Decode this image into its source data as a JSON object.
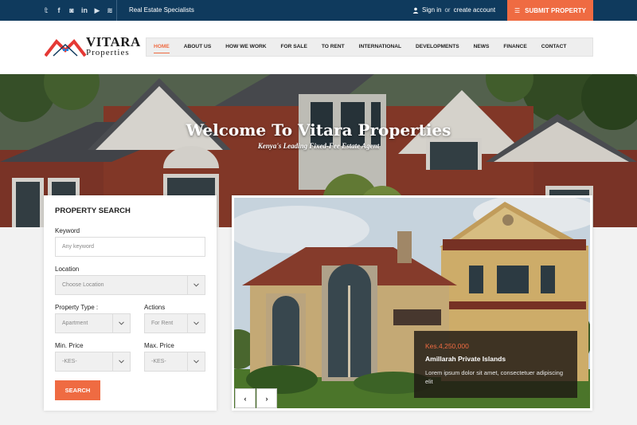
{
  "topbar": {
    "social_icons": [
      "twitter-icon",
      "facebook-icon",
      "instagram-icon",
      "linkedin-icon",
      "youtube-icon",
      "rss-icon"
    ],
    "tagline": "Real Estate Specialists",
    "signin": "Sign in",
    "or": "or",
    "create_account": "create account",
    "submit_property": "SUBMIT PROPERTY"
  },
  "logo": {
    "line1": "VITARA",
    "line2": "Properties"
  },
  "nav": {
    "items": [
      "HOME",
      "ABOUT US",
      "HOW WE WORK",
      "FOR SALE",
      "TO RENT",
      "INTERNATIONAL",
      "DEVELOPMENTS",
      "NEWS",
      "FINANCE",
      "CONTACT"
    ],
    "active": "HOME"
  },
  "hero": {
    "title": "Welcome To Vitara Properties",
    "subtitle": "Kenya's Leading Fixed-Fee Estate Agent"
  },
  "search": {
    "title": "PROPERTY SEARCH",
    "keyword_label": "Keyword",
    "keyword_placeholder": "Any keyword",
    "location_label": "Location",
    "location_value": "Choose Location",
    "type_label": "Property Type :",
    "type_value": "Apartment",
    "actions_label": "Actions",
    "actions_value": "For Rent",
    "min_label": "Min. Price",
    "min_value": "-KES-",
    "max_label": "Max. Price",
    "max_value": "-KES-",
    "button": "SEARCH"
  },
  "slider": {
    "price": "Kes.4,250,000",
    "title": "Amillarah Private Islands",
    "description": "Lorem ipsum dolor sit amet, consectetuer adipiscing elit",
    "prev": "‹",
    "next": "›"
  },
  "colors": {
    "topbar": "#0f3a5d",
    "accent": "#ef6b42"
  }
}
